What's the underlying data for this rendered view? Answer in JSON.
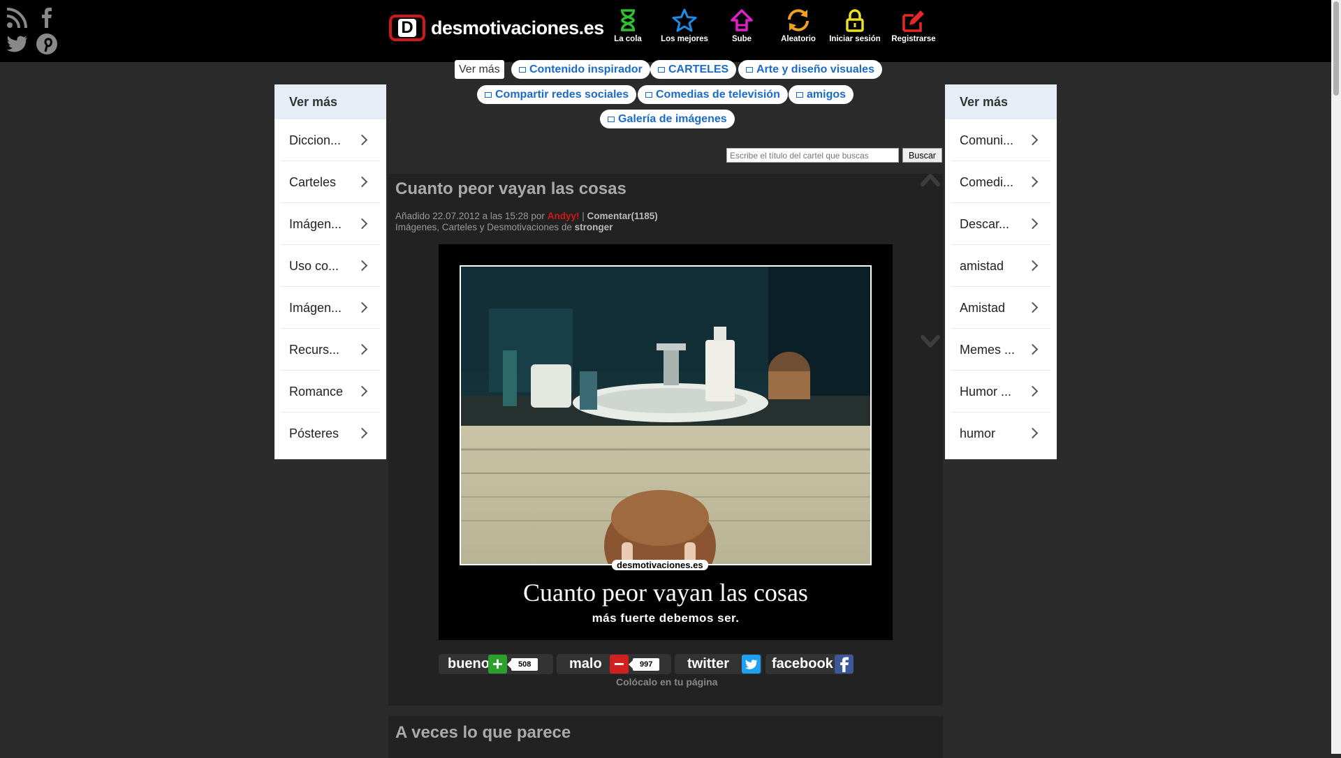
{
  "brand": {
    "name": "desmotivaciones.es",
    "mark": "D"
  },
  "social": [
    {
      "icon": "rss-icon"
    },
    {
      "icon": "facebook-icon"
    },
    {
      "icon": "twitter-icon"
    },
    {
      "icon": "pinterest-icon"
    }
  ],
  "nav": [
    {
      "label": "La cola",
      "icon": "hourglass-icon",
      "color": "#2fc02f"
    },
    {
      "label": "Los mejores",
      "icon": "star-icon",
      "color": "#1a8ee8"
    },
    {
      "label": "Sube",
      "icon": "upload-home-icon",
      "color": "#e020c8"
    },
    {
      "label": "Aleatorio",
      "icon": "refresh-icon",
      "color": "#f0a020"
    },
    {
      "label": "Iniciar sesión",
      "icon": "lock-icon",
      "color": "#e8e020"
    },
    {
      "label": "Registrarse",
      "icon": "register-pencil-icon",
      "color": "#e82828"
    }
  ],
  "tags": {
    "ver_mas": "Ver más",
    "items": [
      "Contenido inspirador",
      "CARTELES",
      "Arte y diseño visuales",
      "Compartir redes sociales",
      "Comedias de televisión",
      "amigos",
      "Galería de imágenes"
    ]
  },
  "search": {
    "placeholder": "Escribe el título del cartel que buscas",
    "button": "Buscar"
  },
  "left_panel": {
    "header": "Ver más",
    "items": [
      "Diccion...",
      "Carteles",
      "Imágen...",
      "Uso co...",
      "Imágen...",
      "Recurs...",
      "Romance",
      "Pósteres"
    ]
  },
  "right_panel": {
    "header": "Ver más",
    "items": [
      "Comuni...",
      "Comedi...",
      "Descar...",
      "amistad",
      "Amistad",
      "Memes ...",
      "Humor ...",
      "humor"
    ]
  },
  "post": {
    "title": "Cuanto peor vayan las cosas",
    "added": "Añadido 22.07.2012 a las 15:28 por",
    "author": "Andyy!",
    "separator": "|",
    "comments": "Comentar(1185)",
    "category_prefix": "Imágenes, Carteles y Desmotivaciones de",
    "category_tag": "stronger",
    "poster": {
      "watermark": "desmotivaciones.es",
      "title": "Cuanto peor vayan las cosas",
      "subtitle": "más fuerte debemos ser."
    },
    "votes": {
      "good_label": "bueno",
      "good_count": "508",
      "bad_label": "malo",
      "bad_count": "997"
    },
    "share": {
      "twitter": "twitter",
      "facebook": "facebook"
    },
    "embed": "Colócalo en tu página"
  },
  "next_post": {
    "title": "A veces lo que parece"
  },
  "colors": {
    "accent": "#1a6bc8",
    "brand_red": "#d01818",
    "good": "#2ca02c",
    "bad": "#d02020",
    "twitter": "#1da1f2",
    "facebook": "#3b5998"
  }
}
